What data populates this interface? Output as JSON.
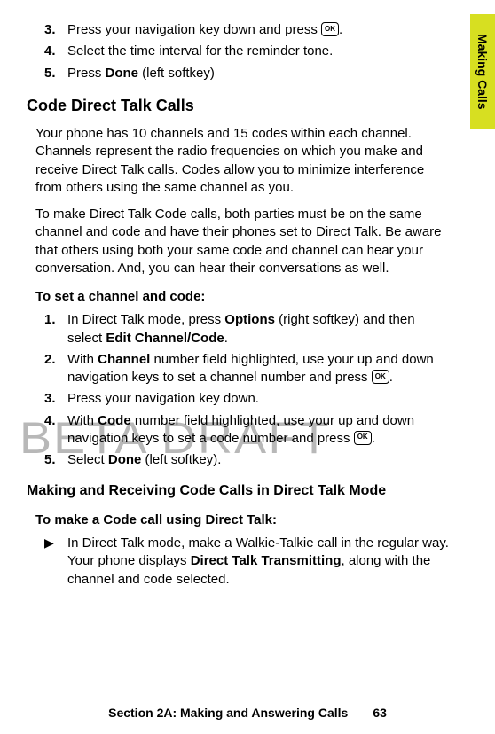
{
  "sideTab": "Making Calls",
  "okLabel": "OK",
  "topSteps": [
    {
      "n": "3.",
      "pre": "Press your navigation key down and press ",
      "ok": true,
      "post": "."
    },
    {
      "n": "4.",
      "text": "Select the time interval for the reminder tone."
    },
    {
      "n": "5.",
      "pre": "Press ",
      "b1": "Done",
      "post": " (left softkey)"
    }
  ],
  "sectionTitle": "Code Direct Talk Calls",
  "para1": "Your phone has 10 channels and 15 codes within each channel. Channels represent the radio frequencies on which you make and receive Direct Talk calls. Codes allow you to minimize interference from others using the same channel as you.",
  "para2": "To make Direct Talk Code calls, both parties must be on the same channel and code and have their phones set to Direct Talk. Be aware that others using both your same code and channel can hear your conversation. And, you can hear their conversations as well.",
  "lead1": "To set a channel and code:",
  "setSteps": [
    {
      "n": "1.",
      "pre": "In Direct Talk mode, press ",
      "b1": "Options",
      "mid": " (right softkey) and then select ",
      "b2": "Edit Channel/Code",
      "post": "."
    },
    {
      "n": "2.",
      "pre": "With ",
      "b1": "Channel",
      "mid": " number field highlighted, use your up and down navigation keys to set a channel number and press ",
      "ok": true,
      "post": "."
    },
    {
      "n": "3.",
      "text": "Press your navigation key down."
    },
    {
      "n": "4.",
      "pre": "With ",
      "b1": "Code",
      "mid": " number field highlighted, use your up and down navigation keys to set a code number and press ",
      "ok": true,
      "post": "."
    },
    {
      "n": "5.",
      "pre": "Select ",
      "b1": "Done",
      "post": " (left softkey)."
    }
  ],
  "subsectionTitle": "Making and Receiving Code Calls in Direct Talk Mode",
  "lead2": "To make a Code call using Direct Talk:",
  "bullet": {
    "sym": "▶",
    "pre": "In Direct Talk mode, make a Walkie-Talkie call in the regular way. Your phone displays ",
    "b1": "Direct Talk Transmitting",
    "post": ", along with the channel and code selected."
  },
  "footerSection": "Section 2A: Making and Answering Calls",
  "footerPage": "63",
  "watermark": "BETA DRAFT"
}
